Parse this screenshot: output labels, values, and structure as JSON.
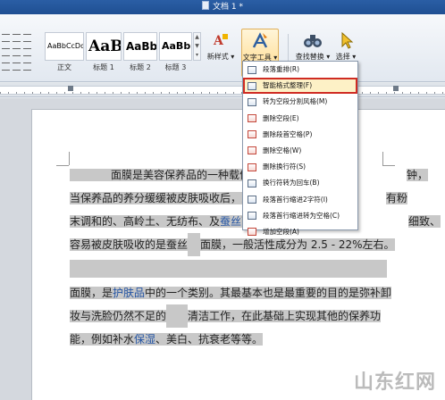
{
  "window": {
    "title": "文档 1 *"
  },
  "ribbon": {
    "styles": [
      {
        "sample": "AaBbCcDd",
        "label": "正文"
      },
      {
        "sample": "AaB",
        "label": "标题 1"
      },
      {
        "sample": "AaBb(",
        "label": "标题 2"
      },
      {
        "sample": "AaBb(",
        "label": "标题 3"
      }
    ],
    "new_style_label": "新样式 ▾",
    "text_tool_label": "文字工具 ▾",
    "find_replace_label": "查找替换 ▾",
    "select_label": "选择 ▾"
  },
  "menu": {
    "items": [
      {
        "label": "段落重排(R)"
      },
      {
        "label": "智能格式整理(F)",
        "highlighted": true
      },
      {
        "label": "转为空段分割风格(M)"
      },
      {
        "label": "删除空段(E)"
      },
      {
        "label": "删除段首空格(P)"
      },
      {
        "label": "删除空格(W)"
      },
      {
        "label": "删除换行符(S)"
      },
      {
        "label": "换行符转为回车(B)"
      },
      {
        "label": "段落首行缩进2字符(I)"
      },
      {
        "label": "段落首行缩进转为空格(C)"
      },
      {
        "label": "增加空段(A)"
      }
    ]
  },
  "document": {
    "p1": {
      "l1": "面膜是美容保养品的一种载体",
      "l1_tail": "钟，",
      "l2": "当保养品的养分缓缓被皮肤吸收后，即",
      "l2_tail": "有粉",
      "l3_a": "末调和的、高岭土、无纺布、及",
      "l3_link": "蚕丝",
      "l3_b": "面",
      "l3_tail": "细致、",
      "l4_a": "容易被皮肤吸收的是蚕丝",
      "l4_b": "面膜，一般活性成分为 2.5 - 22%左右。"
    },
    "p2": {
      "l1_a": "面膜，是",
      "l1_link": "护肤品",
      "l1_b": "中的一个类别。其最基本也是最重要的目的是弥补卸",
      "l2_a": "妆与洗脸仍然不足的",
      "l2_b": "清洁工作，在此基础上实现其他的保养功",
      "l3_a": "能，例如补水",
      "l3_link": "保湿",
      "l3_b": "、美白、抗衰老等等。"
    }
  },
  "watermark": "山东红网"
}
